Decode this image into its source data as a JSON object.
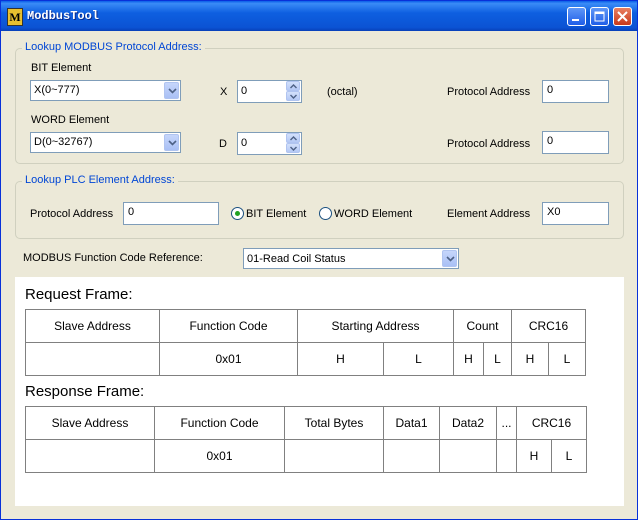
{
  "window": {
    "title": "ModbusTool",
    "icon_letter": "M"
  },
  "lookup_modbus": {
    "legend": "Lookup MODBUS Protocol Address:",
    "bit_label": "BIT Element",
    "bit_select": "X(0~777)",
    "bit_prefix": "X",
    "bit_value": "0",
    "octal_label": "(octal)",
    "bit_protocol_label": "Protocol Address",
    "bit_protocol_value": "0",
    "word_label": "WORD Element",
    "word_select": "D(0~32767)",
    "word_prefix": "D",
    "word_value": "0",
    "word_protocol_label": "Protocol Address",
    "word_protocol_value": "0"
  },
  "lookup_plc": {
    "legend": "Lookup PLC Element Address:",
    "protocol_label": "Protocol Address",
    "protocol_value": "0",
    "bit_radio": "BIT Element",
    "word_radio": "WORD Element",
    "element_label": "Element Address",
    "element_value": "X0"
  },
  "function_ref": {
    "label": "MODBUS Function Code Reference:",
    "selected": "01-Read Coil Status"
  },
  "request": {
    "title": "Request Frame:",
    "headers": [
      "Slave Address",
      "Function Code",
      "Starting Address",
      "Count",
      "CRC16"
    ],
    "row": {
      "function": "0x01",
      "start_h": "H",
      "start_l": "L",
      "count_h": "H",
      "count_l": "L",
      "crc_h": "H",
      "crc_l": "L"
    }
  },
  "response": {
    "title": "Response Frame:",
    "headers": [
      "Slave Address",
      "Function Code",
      "Total Bytes",
      "Data1",
      "Data2",
      "...",
      "CRC16"
    ],
    "row": {
      "function": "0x01",
      "crc_h": "H",
      "crc_l": "L"
    }
  }
}
